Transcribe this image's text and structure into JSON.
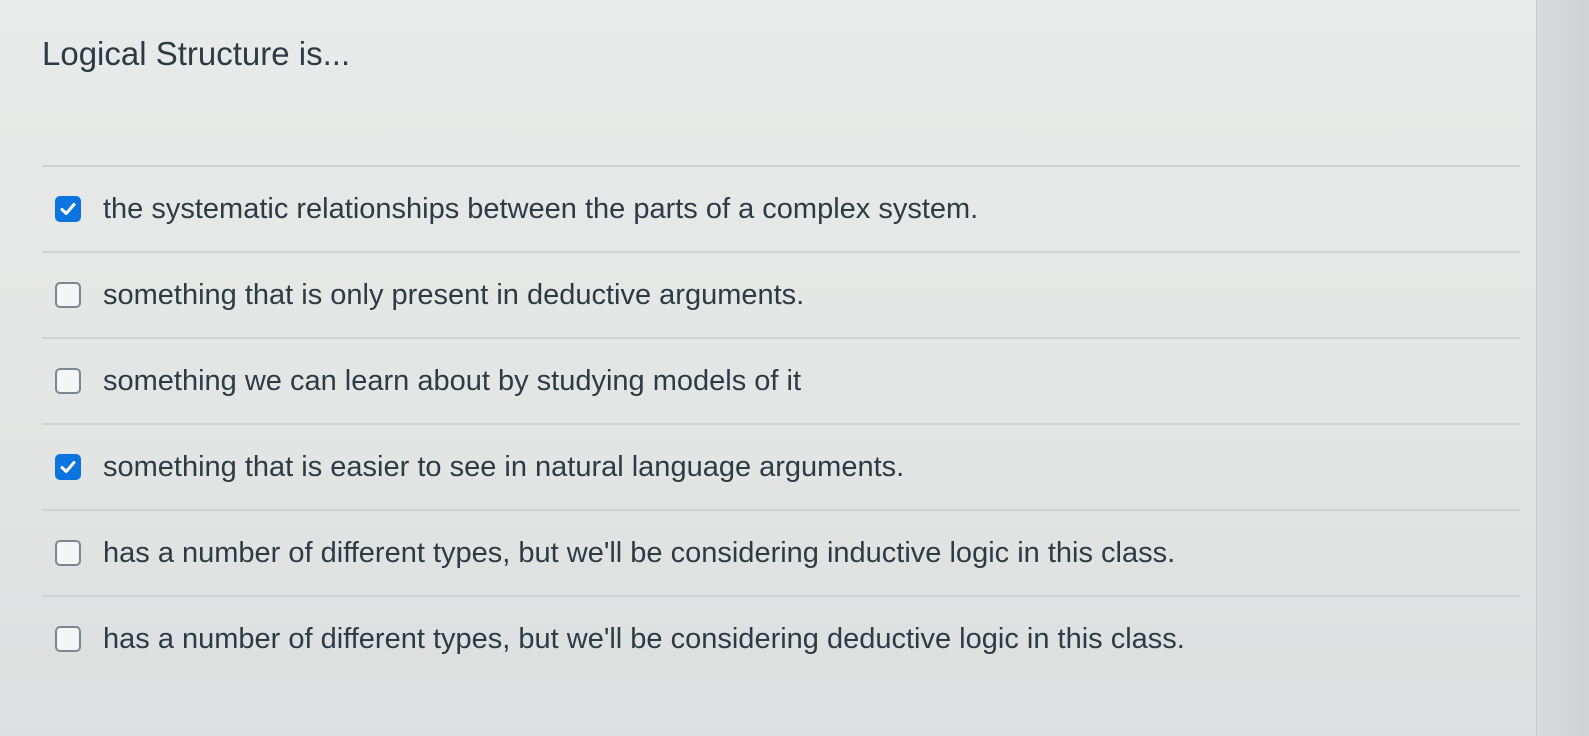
{
  "question": {
    "title": "Logical Structure is..."
  },
  "answers": [
    {
      "text": "the systematic relationships between the parts of a complex system.",
      "checked": true
    },
    {
      "text": "something that is only present in deductive arguments.",
      "checked": false
    },
    {
      "text": "something we can learn about by studying models of it",
      "checked": false
    },
    {
      "text": "something that is easier to see in natural language arguments.",
      "checked": true
    },
    {
      "text": "has a number of different types, but we'll be considering inductive logic in this class.",
      "checked": false
    },
    {
      "text": "has a number of different types, but we'll be considering deductive logic in this class.",
      "checked": false
    }
  ],
  "colors": {
    "checkbox_checked": "#0b74de",
    "text": "#2d3b45",
    "divider": "#cfd3d4"
  },
  "icons": {
    "checked": "checkmark-icon"
  }
}
